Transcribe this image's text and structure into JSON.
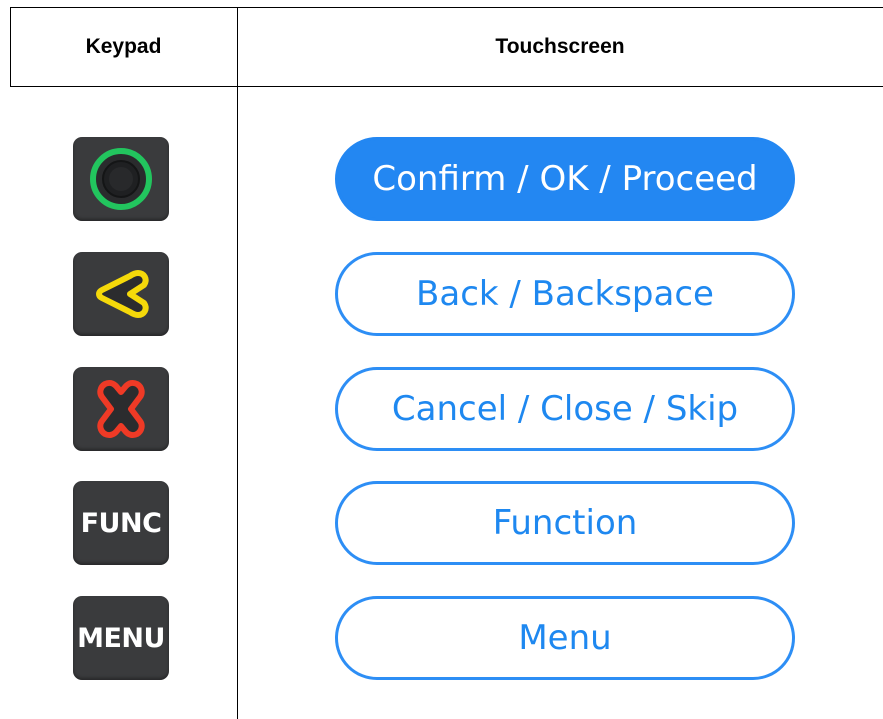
{
  "table": {
    "headers": {
      "keypad": "Keypad",
      "touchscreen": "Touchscreen"
    },
    "rows": [
      {
        "key_icon": "confirm-green-circle-icon",
        "key_label": "",
        "touch_label": "Confirm / OK / Proceed",
        "style": "primary"
      },
      {
        "key_icon": "back-yellow-arrow-icon",
        "key_label": "",
        "touch_label": "Back / Backspace",
        "style": "outline"
      },
      {
        "key_icon": "cancel-red-x-icon",
        "key_label": "",
        "touch_label": "Cancel / Close / Skip",
        "style": "outline"
      },
      {
        "key_icon": "func-key-icon",
        "key_label": "FUNC",
        "touch_label": "Function",
        "style": "outline"
      },
      {
        "key_icon": "menu-key-icon",
        "key_label": "MENU",
        "touch_label": "Menu",
        "style": "outline"
      }
    ]
  },
  "colors": {
    "primary_blue": "#2387f2",
    "outline_blue": "#2d8ef5",
    "key_background": "#3a3b3d",
    "confirm_green": "#22c55e",
    "back_yellow": "#f5d90a",
    "cancel_red": "#ef3a26"
  }
}
